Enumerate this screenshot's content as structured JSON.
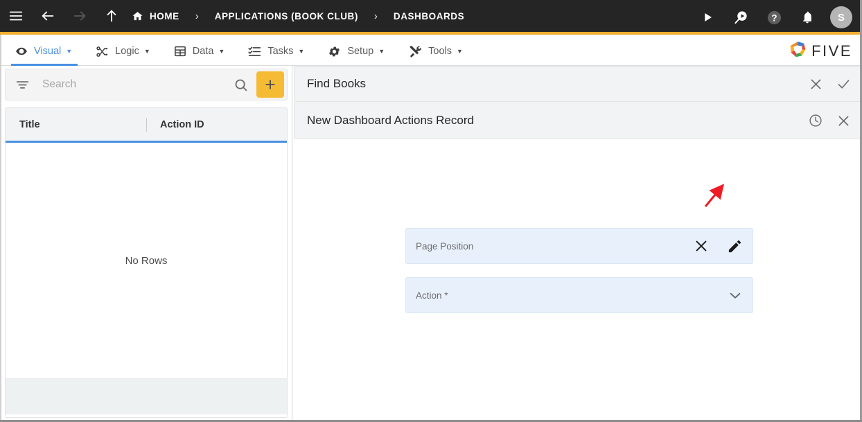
{
  "topbar": {
    "menu_icon": "hamburger-menu-icon",
    "back_icon": "arrow-back-icon",
    "forward_icon": "arrow-forward-icon",
    "up_icon": "arrow-up-icon",
    "breadcrumbs": [
      {
        "label": "HOME",
        "icon": "home-icon"
      },
      {
        "label": "APPLICATIONS (BOOK CLUB)",
        "icon": ""
      },
      {
        "label": "DASHBOARDS",
        "icon": ""
      }
    ],
    "separator": "›",
    "run_icon": "play-run-icon",
    "search_icon": "search-play-icon",
    "help_icon": "help-question-icon",
    "notifications_icon": "bell-notification-icon",
    "avatar_initial": "S",
    "accent_bar_color": "#f0ad2e",
    "background_color": "#252525"
  },
  "subnav": {
    "tabs": [
      {
        "label": "Visual",
        "icon": "eye-icon",
        "caret": "▼",
        "active": true
      },
      {
        "label": "Logic",
        "icon": "logic-nodes-icon",
        "caret": "▼",
        "active": false
      },
      {
        "label": "Data",
        "icon": "table-grid-icon",
        "caret": "▼",
        "active": false
      },
      {
        "label": "Tasks",
        "icon": "checklist-icon",
        "caret": "▼",
        "active": false
      },
      {
        "label": "Setup",
        "icon": "gear-icon",
        "caret": "▼",
        "active": false
      },
      {
        "label": "Tools",
        "icon": "tools-wrench-icon",
        "caret": "▼",
        "active": false
      }
    ],
    "active_color": "#4a90e2",
    "logo_text": "FIVE",
    "logo_icon": "five-pinwheel-logo-icon"
  },
  "left_panel": {
    "filter_icon": "filter-icon",
    "search_placeholder": "Search",
    "search_value": "",
    "search_icon": "search-icon",
    "add_button_label": "+",
    "add_button_color": "#f6bb35",
    "grid": {
      "columns": [
        "Title",
        "Action ID"
      ],
      "empty_message": "No Rows",
      "header_underline_color": "#4a90e2",
      "rows": []
    }
  },
  "right_panel": {
    "form_header": {
      "title": "Find Books",
      "close_icon": "close-x-icon",
      "confirm_icon": "checkmark-icon"
    },
    "record_header": {
      "title": "New Dashboard Actions Record",
      "history_icon": "clock-history-icon",
      "close_icon": "close-x-icon"
    },
    "fields": [
      {
        "label": "Page Position",
        "value": "",
        "type": "lookup",
        "actions": [
          "clear-x-icon",
          "edit-pencil-icon"
        ]
      },
      {
        "label": "Action *",
        "value": "",
        "type": "select",
        "actions": [
          "chevron-down-icon"
        ]
      }
    ],
    "annotation": {
      "type": "red-arrow",
      "color": "#ee1c25",
      "points_to": "edit-pencil-icon"
    }
  }
}
